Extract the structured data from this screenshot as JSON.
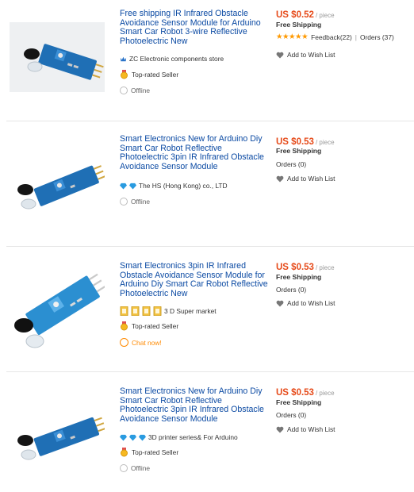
{
  "listings": [
    {
      "title": "Free shipping IR Infrared Obstacle Avoidance Sensor Module for Arduino Smart Car Robot 3-wire Reflective Photoelectric New",
      "seller": "ZC Electronic components store",
      "seller_icon": "crown-icon",
      "seller_badge": "Top-rated Seller",
      "status": "Offline",
      "price": "US $0.52",
      "per_unit": "/ piece",
      "shipping": "Free Shipping",
      "rating_stars": 5,
      "feedback": "Feedback(22)",
      "orders": "Orders (37)",
      "wishlist": "Add to Wish List"
    },
    {
      "title": "Smart Electronics New for Arduino Diy Smart Car Robot Reflective Photoelectric 3pin IR Infrared Obstacle Avoidance Sensor Module",
      "seller": "The HS (Hong Kong) co., LTD",
      "seller_icon": "diamond-icon",
      "status": "Offline",
      "price": "US $0.53",
      "per_unit": "/ piece",
      "shipping": "Free Shipping",
      "orders": "Orders (0)",
      "wishlist": "Add to Wish List"
    },
    {
      "title": "Smart Electronics 3pin IR Infrared Obstacle Avoidance Sensor Module for Arduino Diy Smart Car Robot Reflective Photoelectric New",
      "seller": "3 D Super market",
      "seller_icon": "medal-icon",
      "seller_badge": "Top-rated Seller",
      "status": "Chat now!",
      "price": "US $0.53",
      "per_unit": "/ piece",
      "shipping": "Free Shipping",
      "orders": "Orders (0)",
      "wishlist": "Add to Wish List"
    },
    {
      "title": "Smart Electronics New for Arduino Diy Smart Car Robot Reflective Photoelectric 3pin IR Infrared Obstacle Avoidance Sensor Module",
      "seller": "3D printer series& For Arduino",
      "seller_icon": "diamond-icon",
      "seller_badge": "Top-rated Seller",
      "status": "Offline",
      "price": "US $0.53",
      "per_unit": "/ piece",
      "shipping": "Free Shipping",
      "orders": "Orders (0)",
      "wishlist": "Add to Wish List"
    }
  ],
  "colors": {
    "title": "#0b4aa3",
    "price": "#e64a19",
    "stars": "#ff9900",
    "chat": "#ff8a00",
    "pcb": "#1f6fb5"
  }
}
